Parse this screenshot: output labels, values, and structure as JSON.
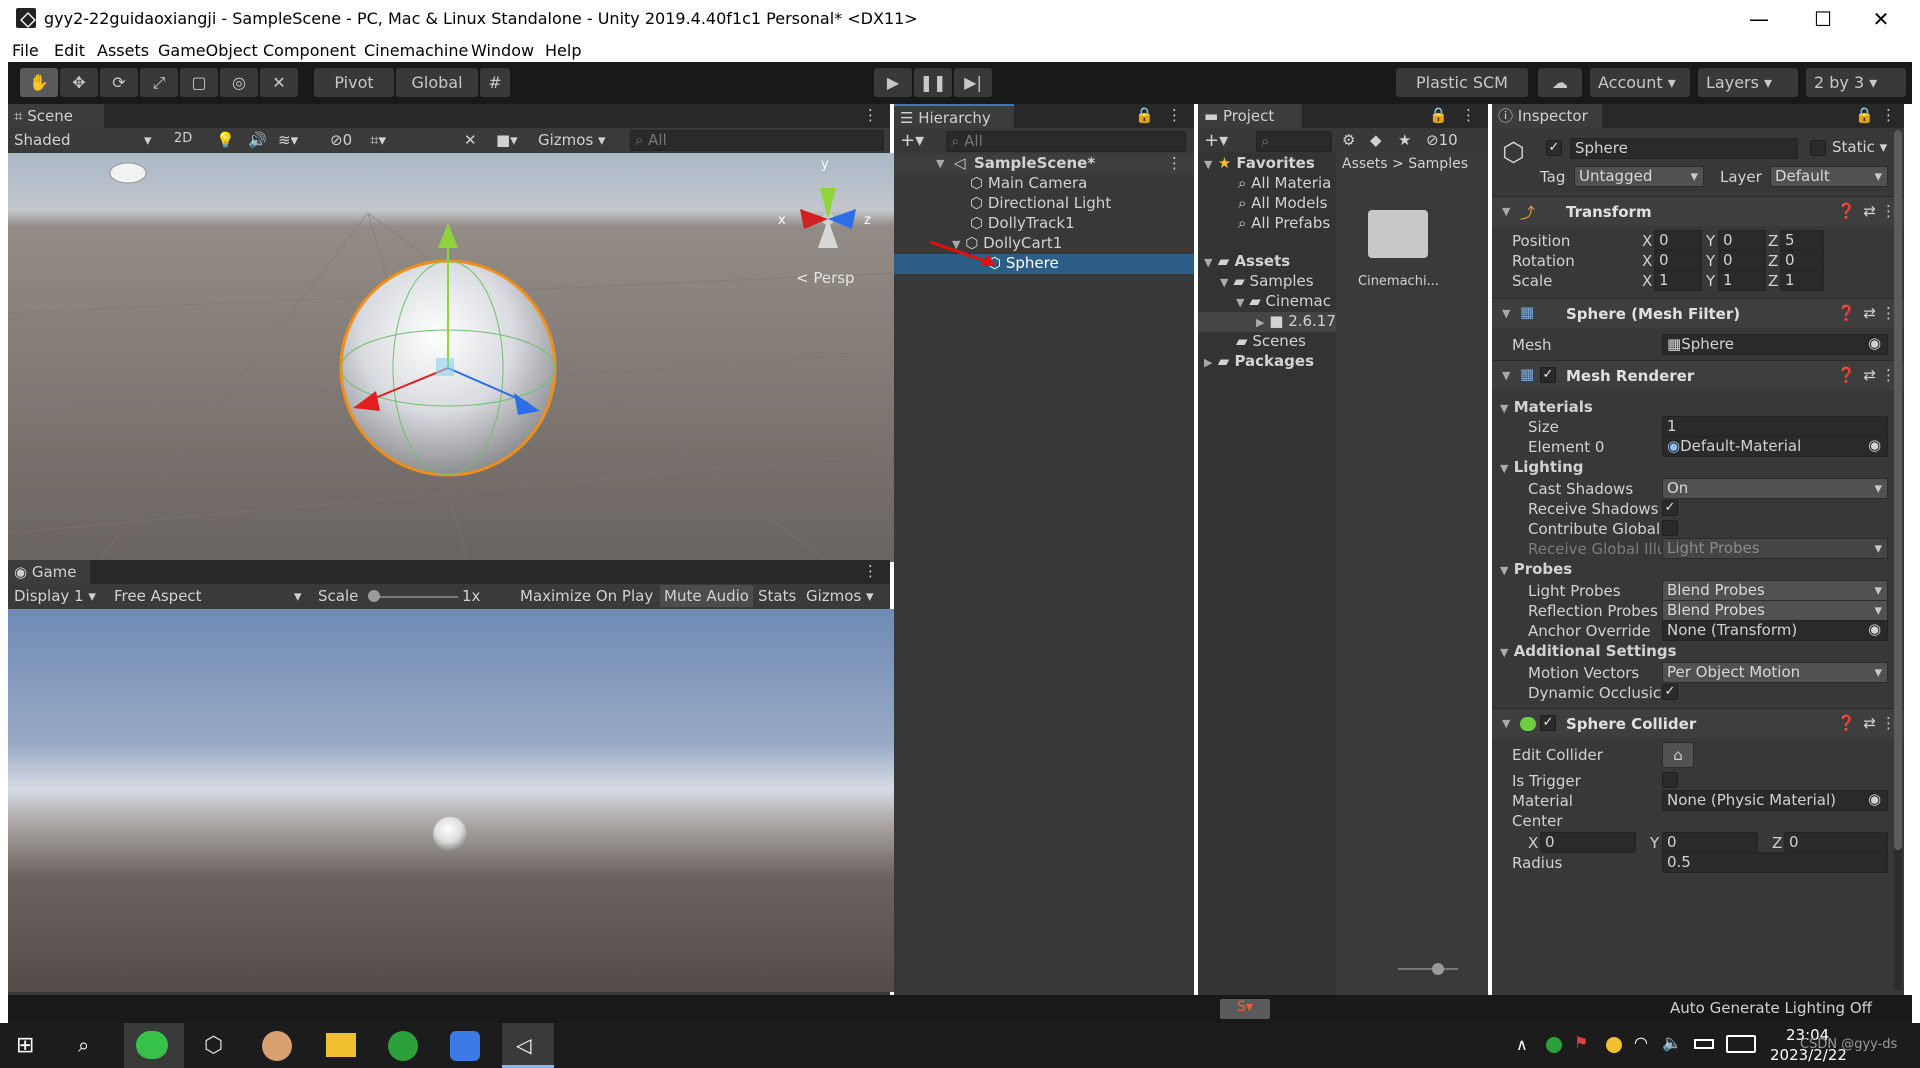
{
  "window": {
    "title": "gyy2-22guidaoxiangji - SampleScene - PC, Mac & Linux Standalone - Unity 2019.4.40f1c1 Personal* <DX11>",
    "minimize": "—",
    "maximize": "☐",
    "close": "✕"
  },
  "menubar": [
    "File",
    "Edit",
    "Assets",
    "GameObject",
    "Component",
    "Cinemachine",
    "Window",
    "Help"
  ],
  "toolbar": {
    "pivot_label": "Pivot",
    "global_label": "Global",
    "plastic_label": "Plastic SCM",
    "account_label": "Account",
    "layers_label": "Layers",
    "layout_label": "2 by 3"
  },
  "scene": {
    "tab_label": "Scene",
    "shading_mode": "Shaded",
    "mode_2d": "2D",
    "hidden_count": "0",
    "gizmos_label": "Gizmos",
    "search_placeholder": "All",
    "persp_label": "< Persp",
    "axis_x": "x",
    "axis_z": "z",
    "axis_y": "y"
  },
  "game": {
    "tab_label": "Game",
    "display_label": "Display 1",
    "aspect_label": "Free Aspect",
    "scale_label": "Scale",
    "scale_value": "1x",
    "maximize_label": "Maximize On Play",
    "mute_label": "Mute Audio",
    "stats_label": "Stats",
    "gizmos_label": "Gizmos"
  },
  "hierarchy": {
    "tab_label": "Hierarchy",
    "search_placeholder": "All",
    "scene_name": "SampleScene*",
    "items": [
      "Main Camera",
      "Directional Light",
      "DollyTrack1",
      "DollyCart1"
    ],
    "selected_item": "Sphere"
  },
  "project": {
    "tab_label": "Project",
    "hidden_count": "10",
    "favorites_label": "Favorites",
    "favorites": [
      "All Materia",
      "All Models",
      "All Prefabs"
    ],
    "assets_label": "Assets",
    "tree": {
      "samples": "Samples",
      "cinemachine": "Cinemac",
      "version": "2.6.17",
      "scenes": "Scenes"
    },
    "packages_label": "Packages",
    "breadcrumb": [
      "Assets",
      "Samples"
    ],
    "breadcrumb_sep": ">",
    "grid_items": [
      "Cinemachi..."
    ]
  },
  "inspector": {
    "tab_label": "Inspector",
    "object_name": "Sphere",
    "static_label": "Static",
    "tag_label": "Tag",
    "tag_value": "Untagged",
    "layer_label": "Layer",
    "layer_value": "Default",
    "transform": {
      "title": "Transform",
      "position_label": "Position",
      "rotation_label": "Rotation",
      "scale_label": "Scale",
      "position": {
        "x": "0",
        "y": "0",
        "z": "5"
      },
      "rotation": {
        "x": "0",
        "y": "0",
        "z": "0"
      },
      "scale": {
        "x": "1",
        "y": "1",
        "z": "1"
      }
    },
    "mesh_filter": {
      "title": "Sphere (Mesh Filter)",
      "mesh_label": "Mesh",
      "mesh_value": "Sphere"
    },
    "mesh_renderer": {
      "title": "Mesh Renderer",
      "materials_label": "Materials",
      "size_label": "Size",
      "size_value": "1",
      "element0_label": "Element 0",
      "element0_value": "Default-Material",
      "lighting_label": "Lighting",
      "cast_shadows_label": "Cast Shadows",
      "cast_shadows_value": "On",
      "receive_shadows_label": "Receive Shadows",
      "contribute_gi_label": "Contribute Global",
      "receive_gi_label": "Receive Global Illu",
      "receive_gi_value": "Light Probes",
      "probes_label": "Probes",
      "light_probes_label": "Light Probes",
      "light_probes_value": "Blend Probes",
      "reflection_probes_label": "Reflection Probes",
      "reflection_probes_value": "Blend Probes",
      "anchor_override_label": "Anchor Override",
      "anchor_override_value": "None (Transform)",
      "additional_label": "Additional Settings",
      "motion_vectors_label": "Motion Vectors",
      "motion_vectors_value": "Per Object Motion",
      "dynamic_occlusion_label": "Dynamic Occlusic"
    },
    "sphere_collider": {
      "title": "Sphere Collider",
      "edit_collider_label": "Edit Collider",
      "is_trigger_label": "Is Trigger",
      "material_label": "Material",
      "material_value": "None (Physic Material)",
      "center_label": "Center",
      "center": {
        "x": "0",
        "y": "0",
        "z": "0"
      },
      "radius_label": "Radius",
      "radius_value": "0.5"
    },
    "checkmark": "✓",
    "axis": {
      "x": "X",
      "y": "Y",
      "z": "Z"
    }
  },
  "statusbar": {
    "text": "Auto Generate Lighting Off"
  },
  "taskbar": {
    "clock_time": "23:04",
    "clock_date": "2023/2/22",
    "watermark": "CSDN @gyy-ds"
  }
}
